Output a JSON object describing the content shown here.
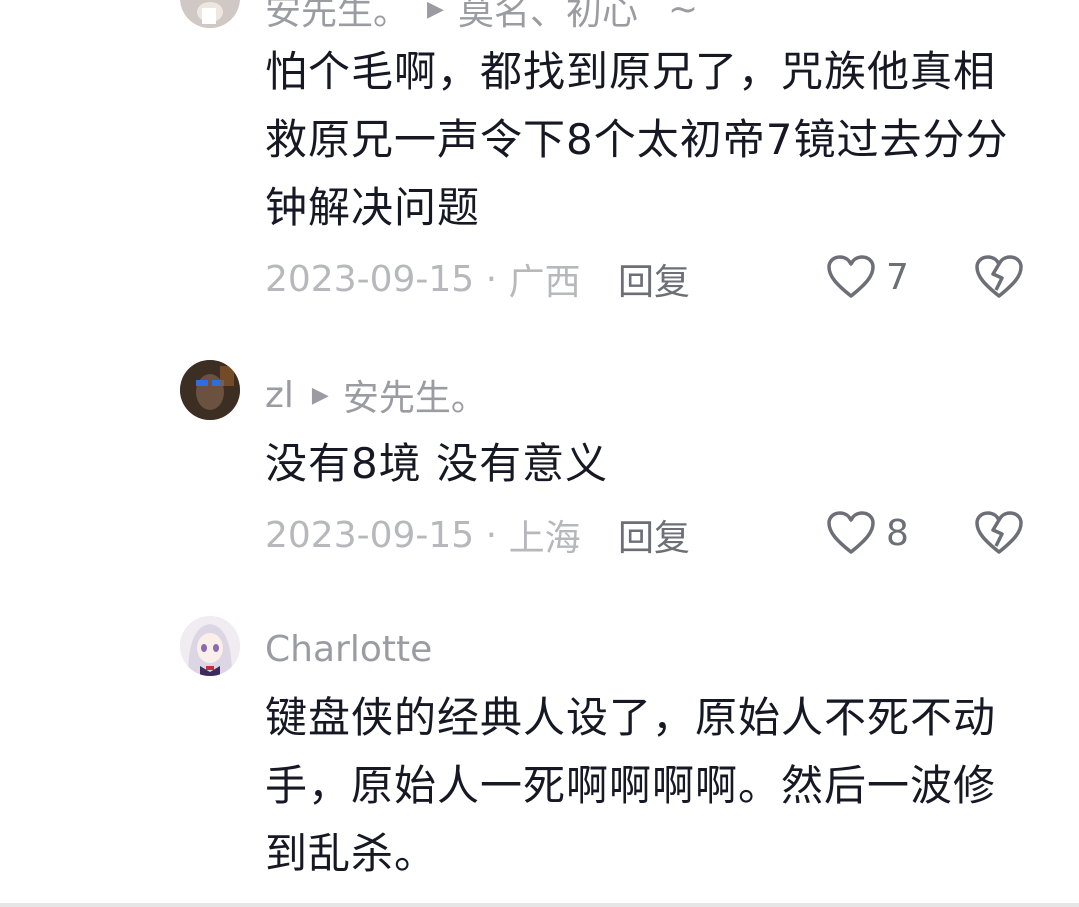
{
  "comments": [
    {
      "author": "安先生。",
      "reply_to": "莫名、初心",
      "extra": "~",
      "text": "怕个毛啊，都找到原兄了，咒族他真相救原兄一声令下8个太初帝7镜过去分分钟解决问题",
      "date": "2023-09-15",
      "location": "广西",
      "reply_label": "回复",
      "likes": "7"
    },
    {
      "author": "zl",
      "reply_to": "安先生。",
      "text": "没有8境 没有意义",
      "date": "2023-09-15",
      "location": "上海",
      "reply_label": "回复",
      "likes": "8"
    },
    {
      "author": "Charlotte",
      "text": "键盘侠的经典人设了，原始人不死不动手，原始人一死啊啊啊啊。然后一波修到乱杀。"
    }
  ],
  "separator": " · ",
  "icons": {
    "like": "heart-outline-icon",
    "dislike": "broken-heart-icon",
    "reply_arrow": "triangle-right-icon"
  }
}
